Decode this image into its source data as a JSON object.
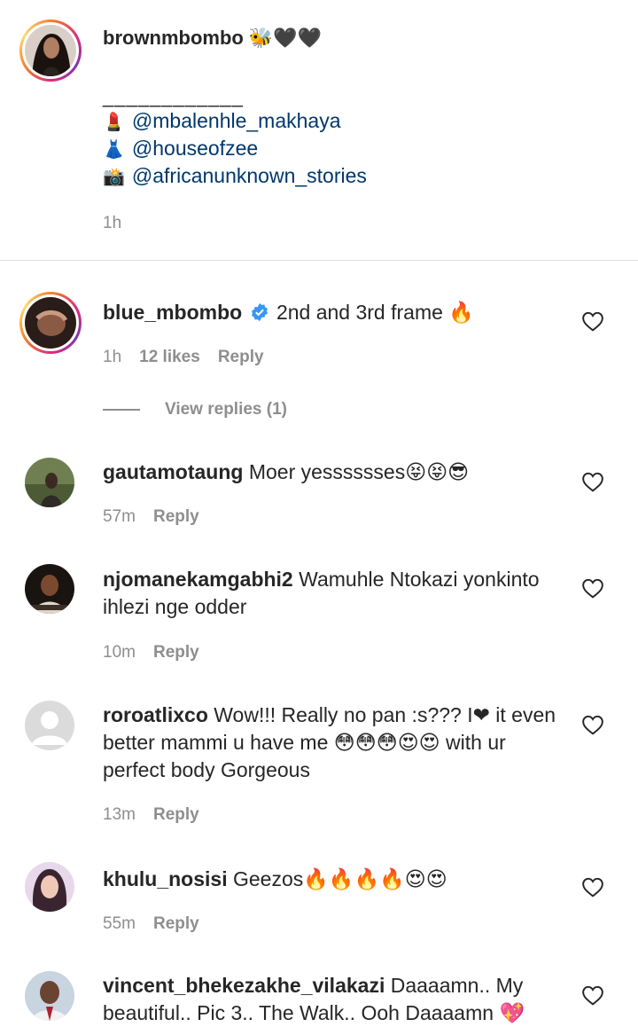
{
  "caption": {
    "username": "brownmbombo",
    "emoji": "🐝🖤🖤",
    "separator": "____________",
    "credits": [
      {
        "icon": "💄",
        "handle": "@mbalenhle_makhaya"
      },
      {
        "icon": "👗",
        "handle": "@houseofzee"
      },
      {
        "icon": "📸",
        "handle": "@africanunknown_stories"
      }
    ],
    "time": "1h"
  },
  "comments": [
    {
      "username": "blue_mbombo",
      "verified": true,
      "text": "2nd and 3rd frame 🔥",
      "time": "1h",
      "likes": "12 likes",
      "reply": "Reply",
      "view_replies": "View replies (1)"
    },
    {
      "username": "gautamotaung",
      "text": "Moer yesssssses😝😝😎",
      "time": "57m",
      "reply": "Reply"
    },
    {
      "username": "njomanekamgabhi2",
      "text": "Wamuhle Ntokazi yonkinto ihlezi nge odder",
      "time": "10m",
      "reply": "Reply"
    },
    {
      "username": "roroatlixco",
      "text": "Wow!!! Really no pan  :s??? I❤ it even better mammi u have me 😳😳😳😍😍 with ur perfect body Gorgeous",
      "time": "13m",
      "reply": "Reply"
    },
    {
      "username": "khulu_nosisi",
      "text": "Geezos🔥🔥🔥🔥😍😍",
      "time": "55m",
      "reply": "Reply"
    },
    {
      "username": "vincent_bhekezakhe_vilakazi",
      "text": "Daaaamn.. My beautiful.. Pic 3.. The Walk.. Ooh Daaaamn 💖"
    }
  ],
  "icons": {
    "heart": "heart-outline-icon",
    "verified": "verified-badge-icon"
  },
  "colors": {
    "link": "#00376b",
    "muted": "#8e8e8e",
    "verified": "#3897f0"
  }
}
